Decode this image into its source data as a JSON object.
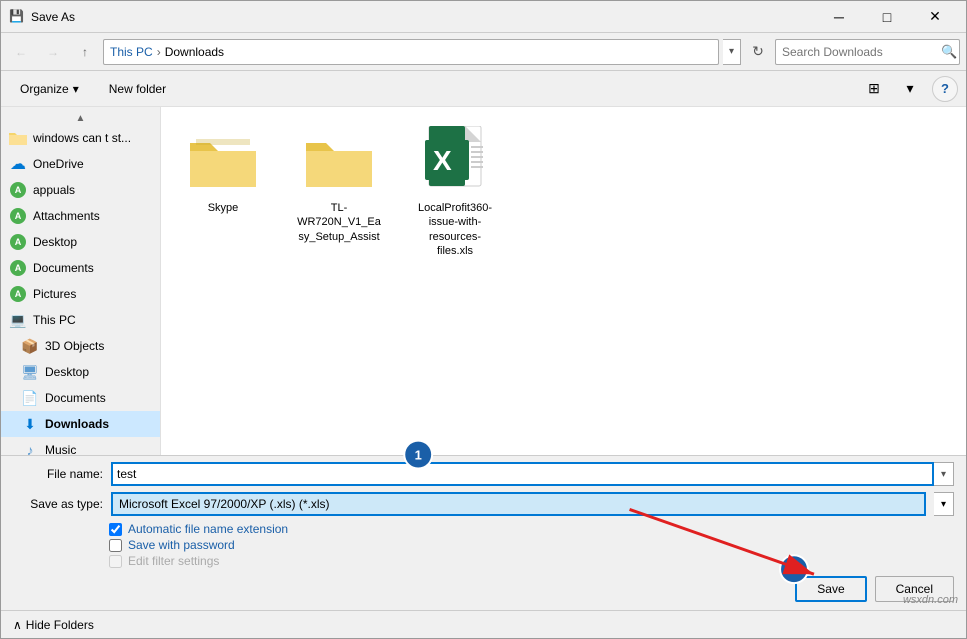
{
  "titlebar": {
    "title": "Save As",
    "close_btn": "✕",
    "icon": "💾"
  },
  "addressbar": {
    "back_btn": "←",
    "forward_btn": "→",
    "up_btn": "↑",
    "this_pc": "This PC",
    "separator": "›",
    "current_folder": "Downloads",
    "search_placeholder": "Search Downloads",
    "refresh_btn": "↻"
  },
  "toolbar": {
    "organize_label": "Organize",
    "new_folder_label": "New folder",
    "organize_arrow": "▾",
    "view_icon": "⊞",
    "help_btn": "?"
  },
  "sidebar": {
    "scroll_up": "▲",
    "items": [
      {
        "id": "windows-cant-start",
        "label": "windows can t st...",
        "icon": "📁",
        "icon_color": "#f5d56b"
      },
      {
        "id": "onedrive",
        "label": "OneDrive",
        "icon": "☁",
        "icon_type": "onedrive"
      },
      {
        "id": "appuals",
        "label": "appuals",
        "icon": "A",
        "icon_type": "green-circle"
      },
      {
        "id": "attachments",
        "label": "Attachments",
        "icon": "A",
        "icon_type": "green-circle"
      },
      {
        "id": "desktop",
        "label": "Desktop",
        "icon": "A",
        "icon_type": "green-circle"
      },
      {
        "id": "documents",
        "label": "Documents",
        "icon": "A",
        "icon_type": "green-circle"
      },
      {
        "id": "pictures",
        "label": "Pictures",
        "icon": "A",
        "icon_type": "green-circle"
      },
      {
        "id": "this-pc",
        "label": "This PC",
        "icon": "💻",
        "icon_type": "thispc"
      },
      {
        "id": "3d-objects",
        "label": "3D Objects",
        "icon": "📦",
        "icon_type": "3dobjects"
      },
      {
        "id": "desktop2",
        "label": "Desktop",
        "icon": "🖥",
        "icon_type": "desktop"
      },
      {
        "id": "documents2",
        "label": "Documents",
        "icon": "📄",
        "icon_type": "documents"
      },
      {
        "id": "downloads",
        "label": "Downloads",
        "icon": "⬇",
        "icon_type": "downloads",
        "selected": true
      },
      {
        "id": "music",
        "label": "Music",
        "icon": "♪",
        "icon_type": "music"
      }
    ],
    "scroll_down": "▼"
  },
  "files": [
    {
      "id": "skype",
      "name": "Skype",
      "type": "folder"
    },
    {
      "id": "tl-wr720n",
      "name": "TL-WR720N_V1_Easy_Setup_Assist",
      "type": "folder"
    },
    {
      "id": "localprofit360",
      "name": "LocalProfit360-issue-with-resources-files.xls",
      "type": "excel"
    }
  ],
  "bottom": {
    "filename_label": "File name:",
    "filename_value": "test",
    "filename_placeholder": "test",
    "saveastype_label": "Save as type:",
    "saveastype_value": "Microsoft Excel 97/2000/XP (.xls) (*.xls)",
    "auto_extension_label": "Automatic file name extension",
    "save_with_password_label": "Save with password",
    "edit_filter_label": "Edit filter settings",
    "save_btn": "Save",
    "cancel_btn": "Cancel",
    "hide_folders_btn": "Hide Folders",
    "chevron_left": "∧"
  },
  "annotations": {
    "circle1_num": "1",
    "circle2_num": "2"
  },
  "watermark": "wsxdn.com"
}
